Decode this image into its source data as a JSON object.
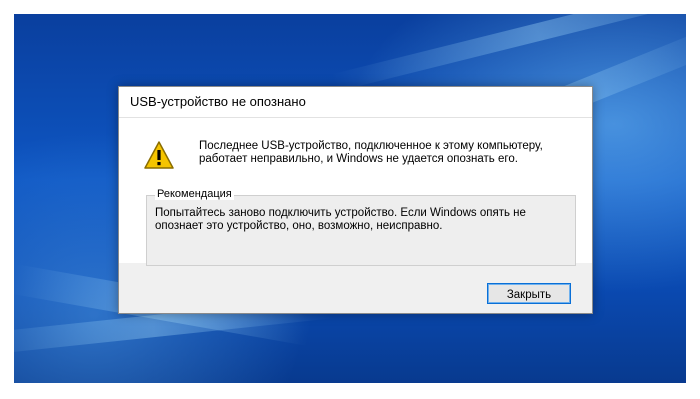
{
  "dialog": {
    "title": "USB-устройство не опознано",
    "icon": "warning-icon",
    "message": "Последнее USB-устройство, подключенное к этому компьютеру, работает неправильно, и Windows не удается опознать его.",
    "recommendation_label": "Рекомендация",
    "recommendation_text": "Попытайтесь заново подключить устройство. Если Windows опять не опознает это устройство, оно, возможно, неисправно.",
    "close_label": "Закрыть"
  },
  "colors": {
    "desktop": "#0e56c3",
    "warning_icon": "#f5c400",
    "button_border": "#0a6fd6"
  }
}
